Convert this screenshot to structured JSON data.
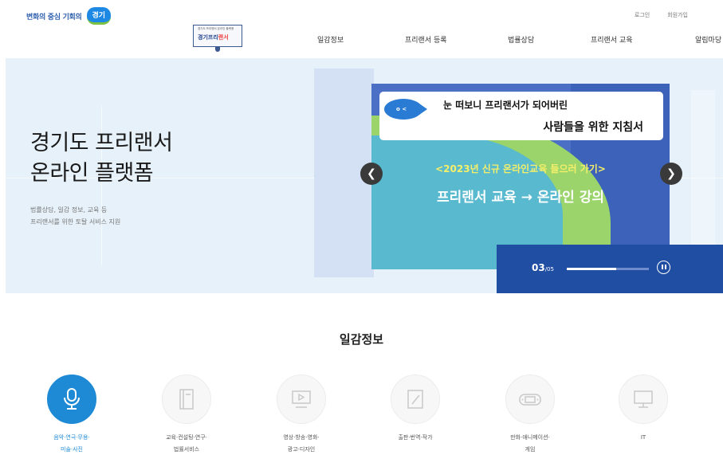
{
  "header": {
    "slogan": "변화의 중심 기회의",
    "badge": "경기",
    "login": "로그인",
    "join": "회원가입"
  },
  "site_logo": {
    "subtitle": "경기도 프리랜서 온라인 플랫폼",
    "name_part1": "경기프리",
    "name_part2": "랜서"
  },
  "gnb": {
    "items": [
      "일감정보",
      "프리랜서 등록",
      "법률상담",
      "프리랜서 교육",
      "알림마당"
    ]
  },
  "hero": {
    "title_line1": "경기도 프리랜서",
    "title_line2": "온라인 플랫폼",
    "desc_line1": "법률상담, 일감 정보, 교육 등",
    "desc_line2": "프리랜서를 위한 토탈 서비스 지원"
  },
  "slide": {
    "banner_line1": "눈 떠보니 프리랜서가 되어버린",
    "banner_line2": "사람들을 위한 지침서",
    "subtitle": "<2023년 신규 온라인교육 들으러 가기>",
    "headline": "프리랜서 교육 → 온라인 강의",
    "current": "03",
    "total": "/05",
    "progress": 0.6
  },
  "section": {
    "title": "일감정보"
  },
  "categories": [
    {
      "line1": "음악·연극·무용·",
      "line2": "미술·사진",
      "icon": "microphone-icon"
    },
    {
      "line1": "교육·컨설팅·연구·",
      "line2": "법률서비스",
      "icon": "book-icon"
    },
    {
      "line1": "영상·방송·영화·",
      "line2": "광고·디자인",
      "icon": "video-play-icon"
    },
    {
      "line1": "출판·번역·작가",
      "line2": "",
      "icon": "pencil-icon"
    },
    {
      "line1": "만화·애니메이션·",
      "line2": "게임",
      "icon": "game-console-icon"
    },
    {
      "line1": "IT",
      "line2": "",
      "icon": "monitor-icon"
    }
  ],
  "colors": {
    "accent": "#1e8ad6",
    "hero_bg": "#e6f1f9",
    "control_bg": "#1f4ea3"
  }
}
